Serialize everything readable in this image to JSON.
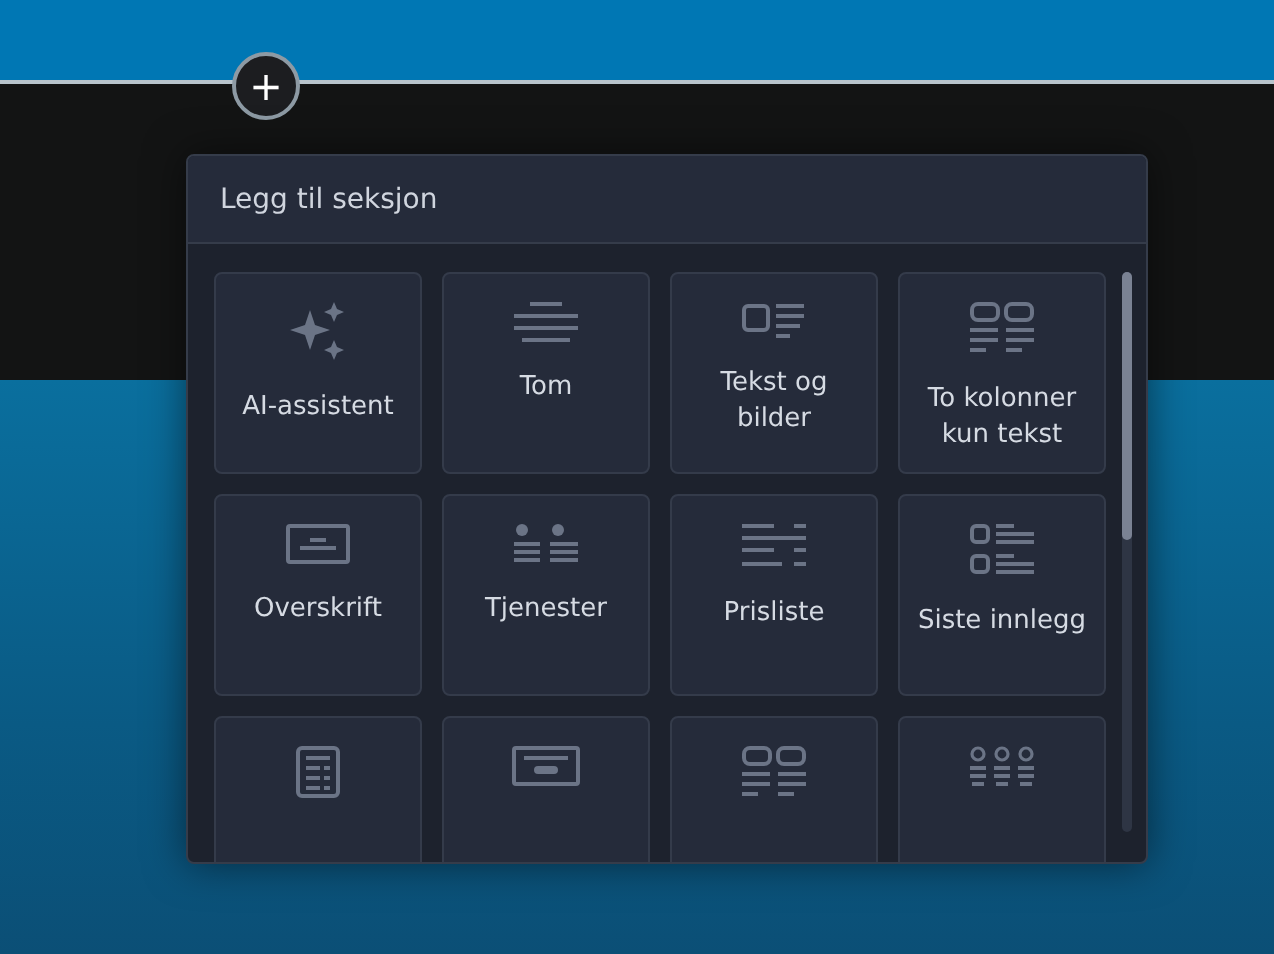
{
  "add_button": {
    "label": "+"
  },
  "popup": {
    "title": "Legg til seksjon",
    "items": [
      {
        "kind": "option",
        "label": "AI-assistent"
      },
      {
        "kind": "option",
        "label": "Tom"
      },
      {
        "kind": "option",
        "label": "Tekst og bilder"
      },
      {
        "kind": "option",
        "label": "To kolonner kun tekst"
      },
      {
        "kind": "option",
        "label": "Overskrift"
      },
      {
        "kind": "option",
        "label": "Tjenester"
      },
      {
        "kind": "option",
        "label": "Prisliste"
      },
      {
        "kind": "option",
        "label": "Siste innlegg"
      },
      {
        "kind": "clipped"
      },
      {
        "kind": "clipped"
      },
      {
        "kind": "clipped"
      },
      {
        "kind": "clipped"
      }
    ]
  }
}
